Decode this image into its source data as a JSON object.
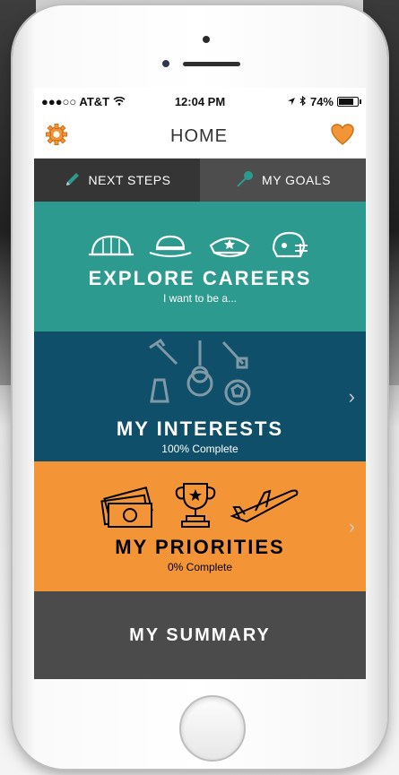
{
  "status_bar": {
    "carrier": "●●●○○ AT&T",
    "time": "12:04 PM",
    "battery": "74%"
  },
  "nav": {
    "title": "HOME"
  },
  "tabs": [
    {
      "label": "NEXT STEPS"
    },
    {
      "label": "MY GOALS"
    }
  ],
  "tiles": {
    "explore": {
      "title": "EXPLORE CAREERS",
      "subtitle": "I want to be a..."
    },
    "interests": {
      "title": "MY INTERESTS",
      "subtitle": "100% Complete"
    },
    "priorities": {
      "title": "MY PRIORITIES",
      "subtitle": "0% Complete"
    },
    "summary": {
      "title": "MY SUMMARY"
    }
  },
  "colors": {
    "explore": "#2c9a8e",
    "interests": "#0f4f6a",
    "priorities": "#f39537",
    "summary": "#4b4b4b",
    "accent_orange": "#f39537"
  }
}
